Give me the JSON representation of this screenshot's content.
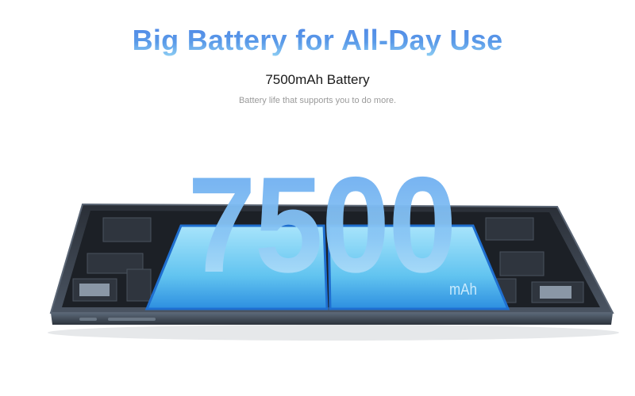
{
  "header": {
    "title": "Big Battery for All-Day Use",
    "subtitle": "7500mAh Battery",
    "tagline": "Battery life that supports you to do more."
  },
  "hero": {
    "capacity_number": "7500",
    "capacity_unit": "mAh"
  },
  "colors": {
    "title_blue": "#4f86e6",
    "battery_cyan": "#5cc6f2",
    "tablet_frame": "#3a4452"
  }
}
